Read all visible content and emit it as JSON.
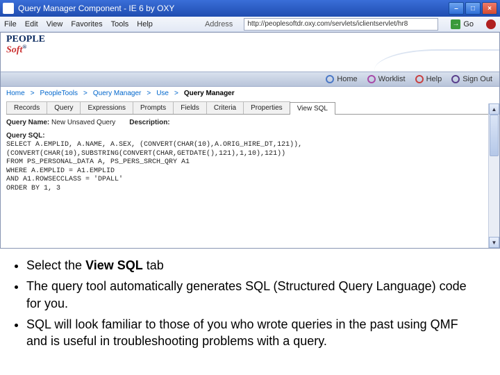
{
  "window": {
    "title": "Query Manager Component - IE 6 by OXY"
  },
  "menu": {
    "items": [
      "File",
      "Edit",
      "View",
      "Favorites",
      "Tools",
      "Help"
    ],
    "address_label": "Address",
    "url": "http://peoplesoftdr.oxy.com/servlets/iclientservlet/hr8",
    "go_label": "Go"
  },
  "logo": {
    "line1": "PEOPLE",
    "line2": "Soft",
    "reg": "®"
  },
  "topnav": [
    {
      "label": "Home",
      "ring": "ring-blue"
    },
    {
      "label": "Worklist",
      "ring": "ring-mag"
    },
    {
      "label": "Help",
      "ring": "ring-red"
    },
    {
      "label": "Sign Out",
      "ring": "ring-dark"
    }
  ],
  "breadcrumb": [
    "Home",
    "PeopleTools",
    "Query Manager",
    "Use",
    "Query Manager"
  ],
  "tabs": [
    "Records",
    "Query",
    "Expressions",
    "Prompts",
    "Fields",
    "Criteria",
    "Properties",
    "View SQL"
  ],
  "active_tab": 7,
  "query": {
    "name_label": "Query Name:",
    "name_value": "New Unsaved Query",
    "desc_label": "Description:",
    "desc_value": "",
    "sql_label": "Query SQL:",
    "sql": "SELECT A.EMPLID, A.NAME, A.SEX, (CONVERT(CHAR(10),A.ORIG_HIRE_DT,121)), (CONVERT(CHAR(10),SUBSTRING(CONVERT(CHAR,GETDATE(),121),1,10),121))\nFROM PS_PERSONAL_DATA A, PS_PERS_SRCH_QRY A1\nWHERE A.EMPLID = A1.EMPLID\nAND A1.ROWSECCLASS = 'DPALL'\nORDER BY 1, 3"
  },
  "notes": [
    {
      "pre": "Select the ",
      "bold": "View SQL",
      "post": " tab"
    },
    {
      "plain": "The query tool automatically generates SQL (Structured Query Language) code for you."
    },
    {
      "plain": "SQL will look familiar to those of you who wrote queries in the past using QMF and is useful in troubleshooting problems with a query."
    }
  ]
}
